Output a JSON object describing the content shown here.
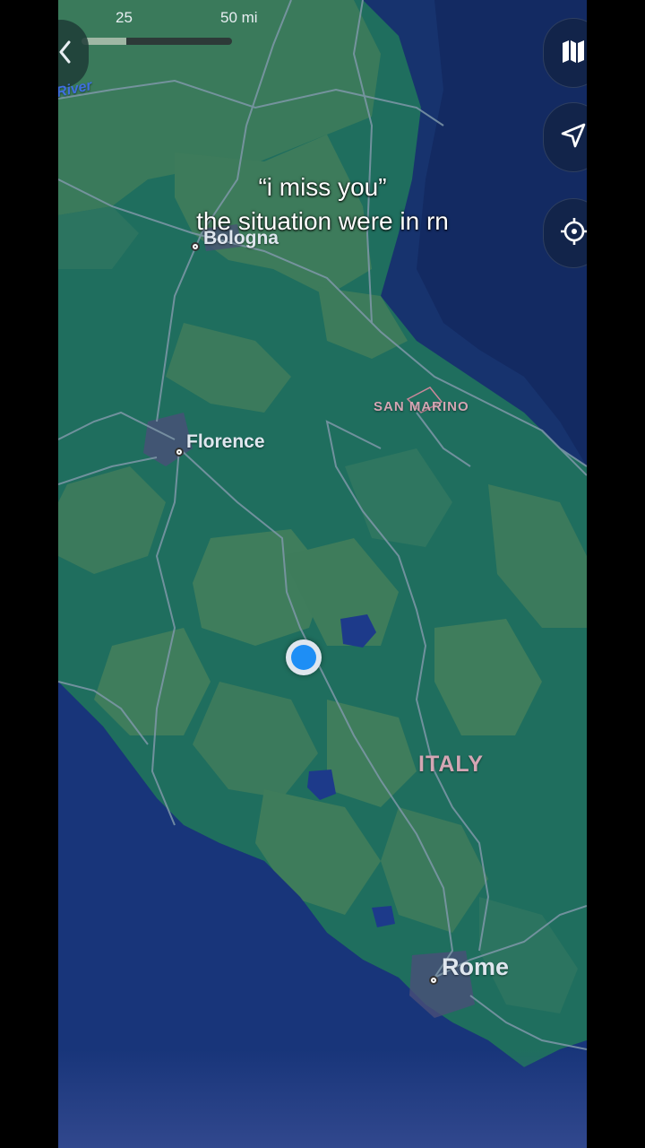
{
  "scale": {
    "label_25": "25",
    "label_50": "50 mi",
    "fill_fraction": 0.3
  },
  "places": {
    "river": "River",
    "bologna": "Bologna",
    "florence": "Florence",
    "san_marino": "SAN MARINO",
    "italy": "ITALY",
    "rome": "Rome"
  },
  "caption": {
    "line1": "“i miss you”",
    "line2": "the situation were in rn"
  },
  "controls": {
    "back_icon": "chevron-left-icon",
    "map_icon": "map-icon",
    "navigate_icon": "navigation-arrow-icon",
    "locate_icon": "crosshair-icon"
  },
  "colors": {
    "land_dark": "#1f6e5e",
    "land_light": "#3f7d5c",
    "sea": "#17336e",
    "user_dot": "#1e8ef5"
  }
}
